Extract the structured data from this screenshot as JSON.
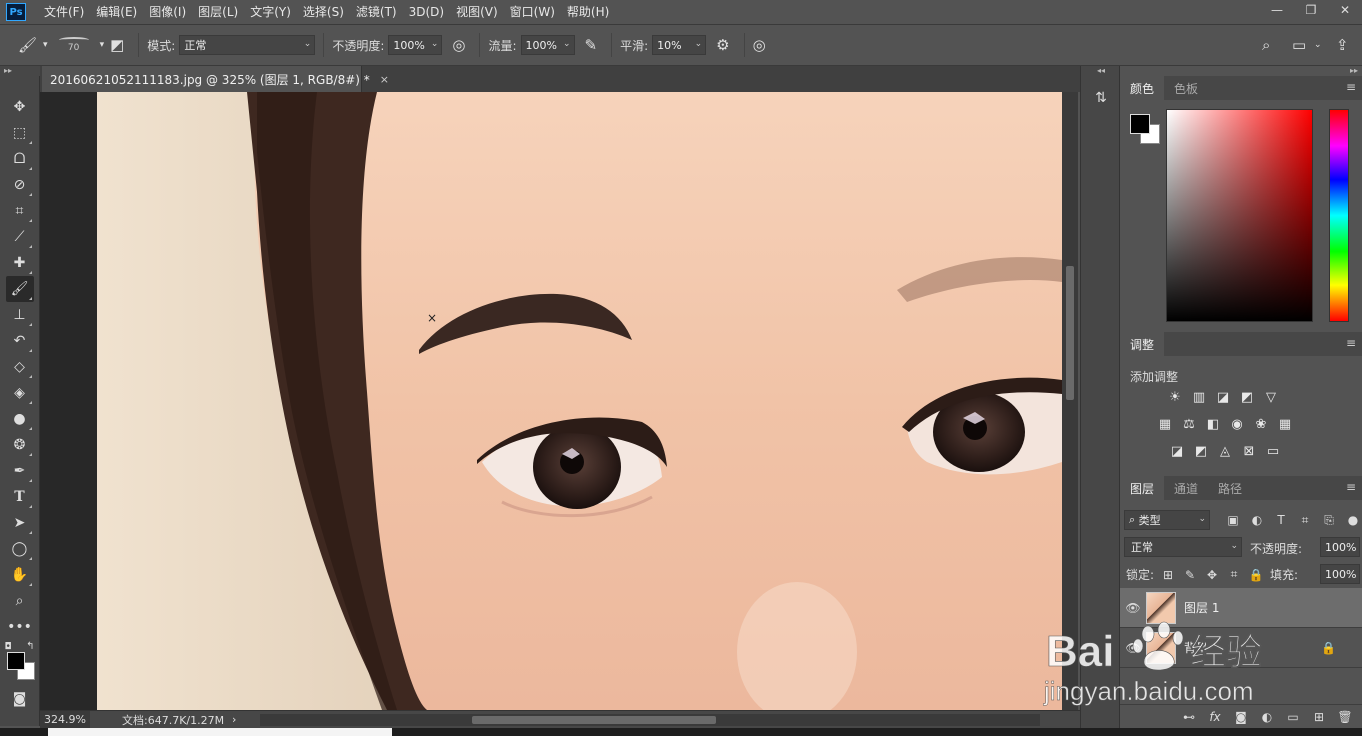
{
  "menubar": {
    "logo": "Ps",
    "items": [
      "文件(F)",
      "编辑(E)",
      "图像(I)",
      "图层(L)",
      "文字(Y)",
      "选择(S)",
      "滤镜(T)",
      "3D(D)",
      "视图(V)",
      "窗口(W)",
      "帮助(H)"
    ]
  },
  "window_controls": {
    "minimize": "—",
    "restore": "❐",
    "close": "✕"
  },
  "options": {
    "brush_size": "70",
    "mode_label": "模式:",
    "mode_value": "正常",
    "opacity_label": "不透明度:",
    "opacity_value": "100%",
    "flow_label": "流量:",
    "flow_value": "100%",
    "smoothing_label": "平滑:",
    "smoothing_value": "10%"
  },
  "document": {
    "tab_title": "20160621052111183.jpg @ 325% (图层 1, RGB/8#) *",
    "close": "×"
  },
  "status": {
    "zoom": "324.9%",
    "doc_info": "文档:647.7K/1.27M",
    "arrow": "›"
  },
  "panels": {
    "color_tabs": [
      "颜色",
      "色板"
    ],
    "adjust_tab": "调整",
    "adjust_label": "添加调整",
    "layers_tabs": [
      "图层",
      "通道",
      "路径"
    ],
    "layer_filter": "类型",
    "blend_mode": "正常",
    "opacity_label": "不透明度:",
    "opacity_value": "100%",
    "lock_label": "锁定:",
    "fill_label": "填充:",
    "fill_value": "100%",
    "layers": [
      {
        "name": "图层 1",
        "visible": true,
        "selected": true
      },
      {
        "name": "背景",
        "visible": true,
        "locked": true
      }
    ]
  },
  "watermark": {
    "brand": "Bai",
    "brand_cn": "经验",
    "url": "jingyan.baidu.com"
  },
  "colors": {
    "ui_bg": "#535353",
    "panel_dark": "#474747",
    "canvas_bg": "#282828",
    "skin": "#f2c9ad",
    "accent_blue": "#31a8ff"
  },
  "icons": {
    "tools": [
      "move-icon",
      "marquee-icon",
      "lasso-icon",
      "quick-select-icon",
      "crop-icon",
      "eyedropper-icon",
      "healing-icon",
      "brush-icon",
      "stamp-icon",
      "history-brush-icon",
      "eraser-icon",
      "paint-bucket-icon",
      "dodge-icon",
      "blur-icon",
      "pen-icon",
      "type-icon",
      "path-select-icon",
      "ellipse-icon",
      "hand-icon",
      "zoom-icon",
      "more-icon"
    ]
  }
}
